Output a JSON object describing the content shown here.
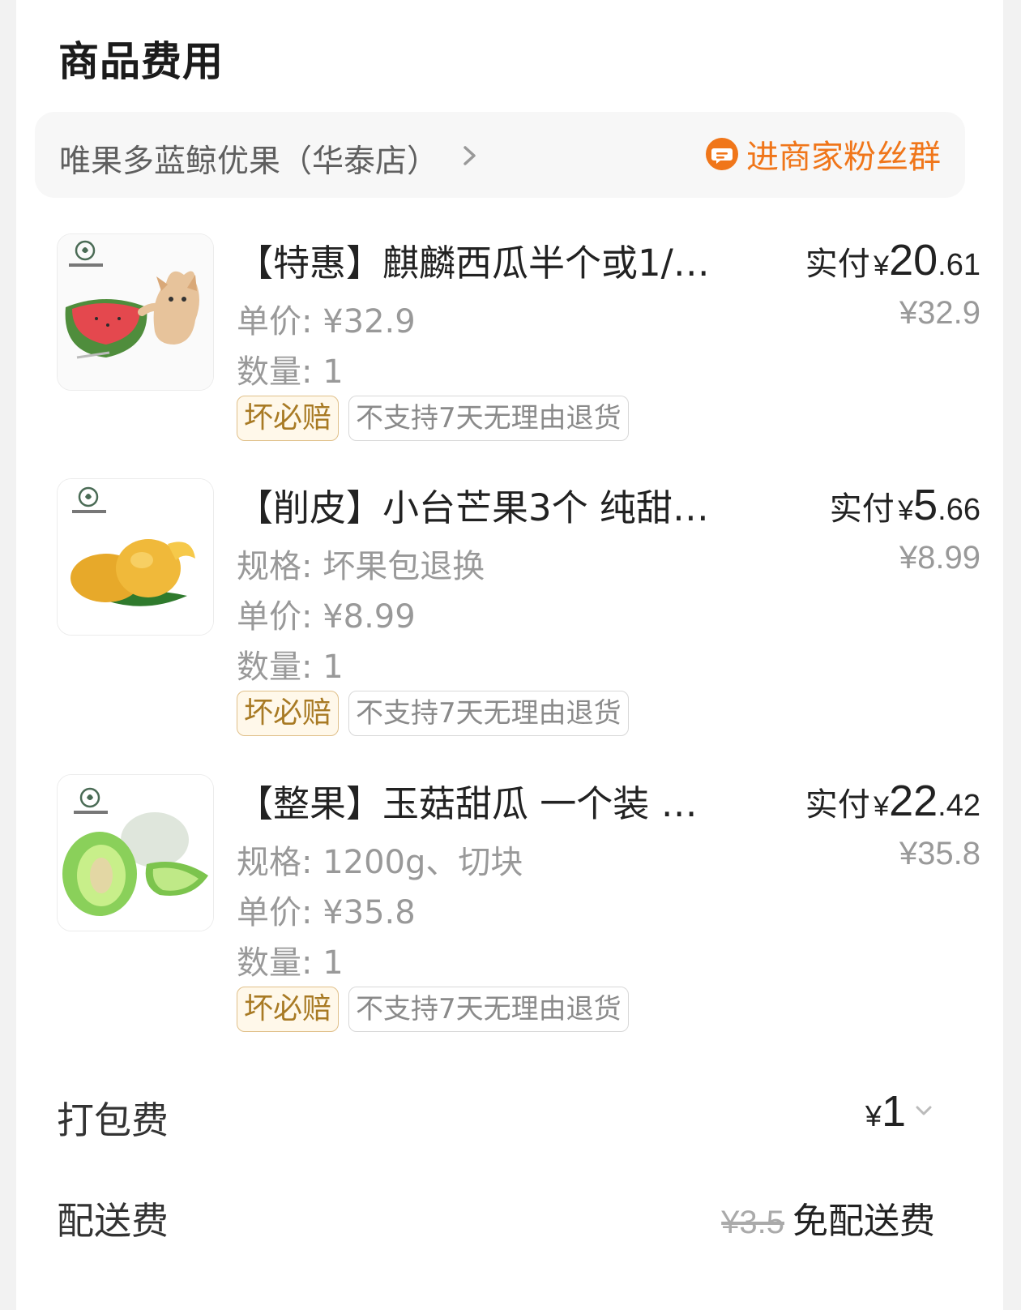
{
  "section": {
    "title": "商品费用"
  },
  "shop": {
    "name": "唯果多蓝鲸优果（华泰店）",
    "fans_group_label": "进商家粉丝群"
  },
  "colors": {
    "accent": "#f0761a",
    "gold_tag_text": "#a87a24",
    "muted": "#999999"
  },
  "products": [
    {
      "name": "【特惠】麒麟西瓜半个或1/…",
      "pay_label": "实付",
      "pay_currency": "¥",
      "pay_int": "20",
      "pay_dec": ".61",
      "original_price": "¥32.9",
      "lines": [
        "单价: ¥32.9",
        "数量: 1"
      ],
      "tag_guarantee": "坏必赔",
      "tag_return": "不支持7天无理由退货",
      "image": "watermelon-with-kitten"
    },
    {
      "name": "【削皮】小台芒果3个 纯甜…",
      "pay_label": "实付",
      "pay_currency": "¥",
      "pay_int": "5",
      "pay_dec": ".66",
      "original_price": "¥8.99",
      "lines": [
        "规格: 坏果包退换",
        "单价: ¥8.99",
        "数量: 1"
      ],
      "tag_guarantee": "坏必赔",
      "tag_return": "不支持7天无理由退货",
      "image": "mango"
    },
    {
      "name": "【整果】玉菇甜瓜 一个装 …",
      "pay_label": "实付",
      "pay_currency": "¥",
      "pay_int": "22",
      "pay_dec": ".42",
      "original_price": "¥35.8",
      "lines": [
        "规格: 1200g、切块",
        "单价: ¥35.8",
        "数量: 1"
      ],
      "tag_guarantee": "坏必赔",
      "tag_return": "不支持7天无理由退货",
      "image": "melon"
    }
  ],
  "fees": {
    "packing": {
      "label": "打包费",
      "currency": "¥",
      "value": "1"
    },
    "delivery": {
      "label": "配送费",
      "original": "¥3.5",
      "value": "免配送费"
    }
  }
}
